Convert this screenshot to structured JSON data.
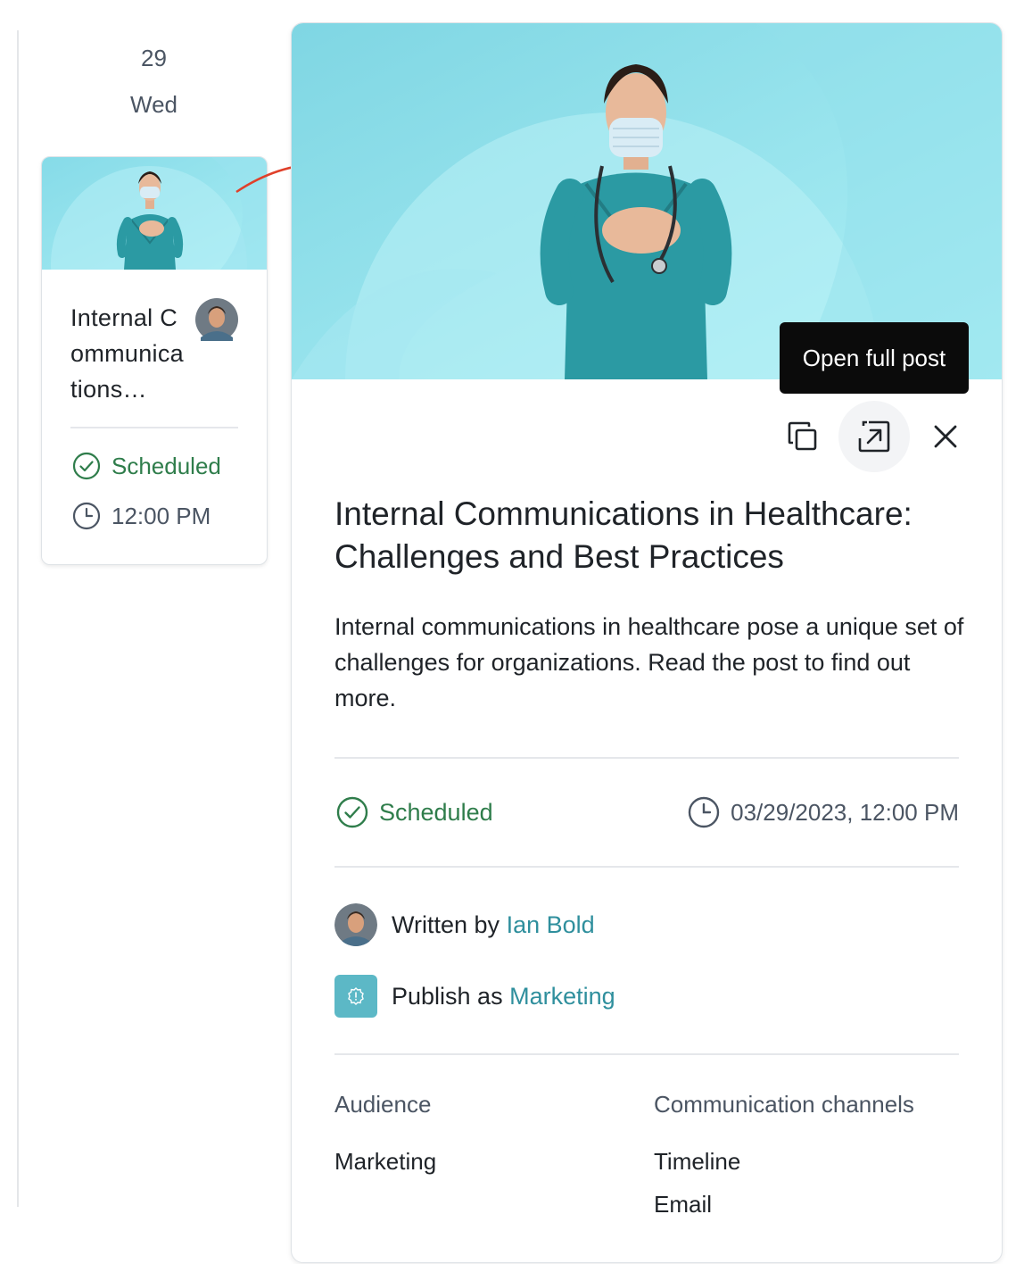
{
  "calendar": {
    "day_number": "29",
    "day_name": "Wed"
  },
  "event_card": {
    "title": "Internal Communications…",
    "status": "Scheduled",
    "time": "12:00 PM"
  },
  "detail": {
    "tooltip": "Open full post",
    "title": "Internal Communications in Healthcare: Challenges and Best Practices",
    "description": "Internal communications in healthcare pose a unique set of challenges for organizations. Read the post to find out more.",
    "status": "Scheduled",
    "datetime": "03/29/2023, 12:00 PM",
    "written_by_prefix": "Written by",
    "author": "Ian Bold",
    "publish_as_prefix": "Publish as",
    "publisher": "Marketing",
    "audience_label": "Audience",
    "audience_values": [
      "Marketing"
    ],
    "channels_label": "Communication channels",
    "channels_values": [
      "Timeline",
      "Email"
    ]
  },
  "icons": {
    "copy": "copy-icon",
    "open": "open-external-icon",
    "close": "close-icon",
    "status": "check-circle-icon",
    "clock": "clock-icon",
    "publisher": "badge-icon"
  },
  "colors": {
    "scheduled_green": "#2f7d4b",
    "link_teal": "#2f8f9d",
    "hero_bg": "#7fd6e3",
    "arrow_red": "#e0402a"
  }
}
